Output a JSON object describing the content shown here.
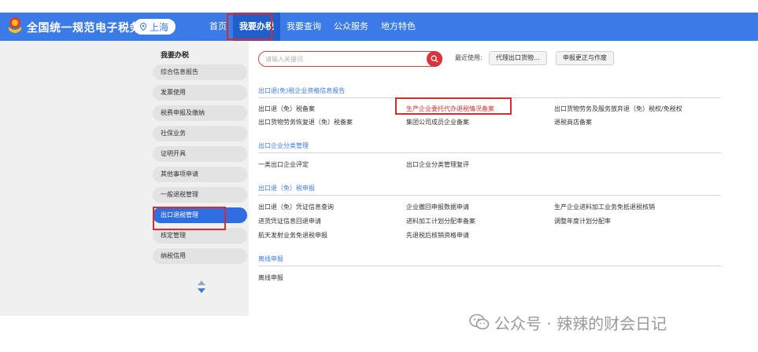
{
  "header": {
    "title": "全国统一规范电子税务局",
    "region": "上海",
    "nav": [
      "首页",
      "我要办税",
      "我要查询",
      "公众服务",
      "地方特色"
    ],
    "active_nav": "我要办税"
  },
  "sidebar": {
    "title": "我要办税",
    "items": [
      {
        "label": "综合信息报告"
      },
      {
        "label": "发票使用"
      },
      {
        "label": "税费申报及缴纳"
      },
      {
        "label": "社保业务"
      },
      {
        "label": "证明开具"
      },
      {
        "label": "其他事项申请"
      },
      {
        "label": "一般退税管理"
      },
      {
        "label": "出口退税管理"
      },
      {
        "label": "核定管理"
      },
      {
        "label": "纳税信用"
      }
    ],
    "active_item": "出口退税管理"
  },
  "search": {
    "placeholder": "请输入关键词",
    "recent_label": "最近使用:",
    "recent_items": [
      "代理出口货物...",
      "申报更正与作废"
    ]
  },
  "sections": [
    {
      "title": "出口退(免)税企业资格信息报告",
      "links": [
        "出口退（免）税备案",
        "生产企业委托代办退税情况备案",
        "出口货物劳务及服务放弃退（免）税权/免税权",
        "出口货物劳务恢复退（免）税备案",
        "集团公司成员企业备案",
        "退税商店备案"
      ]
    },
    {
      "title": "出口企业分类管理",
      "links": [
        "一类出口企业评定",
        "出口企业分类管理复评"
      ]
    },
    {
      "title": "出口退（免）税申报",
      "links": [
        "出口退（免）凭证信息查询",
        "企业撤回申报数据申请",
        "生产企业进料加工业务免抵退税核销",
        "进货凭证信息回退申请",
        "进料加工计划分配率备案",
        "调整年度计划分配率",
        "航天发射业务免退税申报",
        "先退税后核销资格申请"
      ]
    },
    {
      "title": "离线申报",
      "links": [
        "离线申报"
      ]
    }
  ],
  "watermark": "公众号 · 辣辣的财会日记",
  "colors": {
    "header_blue": "#3b7be8",
    "active_blue": "#2f6ee0",
    "highlight_red": "#d92b2b",
    "section_blue": "#3b7be8"
  }
}
